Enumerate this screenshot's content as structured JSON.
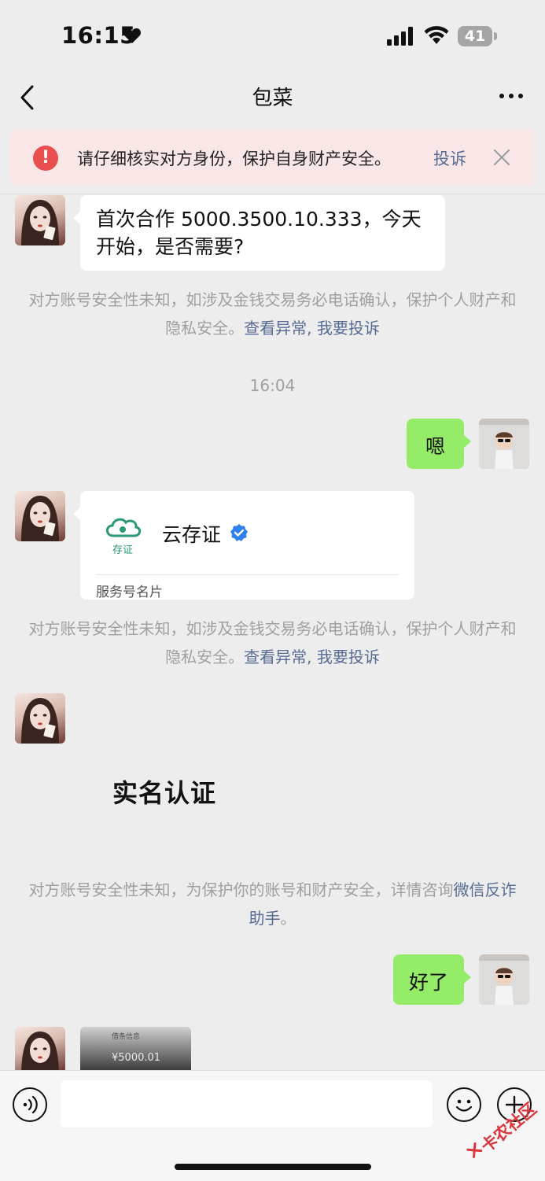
{
  "status_bar": {
    "time": "16:15",
    "battery_level": "41"
  },
  "nav": {
    "title": "包菜"
  },
  "warning": {
    "text": "请仔细核实对方身份，保护自身财产安全。",
    "report_label": "投诉"
  },
  "messages": {
    "msg1_text": "首次合作 5000.3500.10.333，今天开始，是否需要?",
    "timestamp": "16:04",
    "msg2_text": "嗯",
    "card": {
      "name": "云存证",
      "logo_label": "存证",
      "type_label": "服务号名片"
    },
    "realname_text": "实名认证",
    "msg3_text": "好了",
    "photo_line": "借条信息",
    "photo_amount": "¥5000.01"
  },
  "system_notices": {
    "notice_a_text": "对方账号安全性未知，如涉及金钱交易务必电话确认，保护个人财产和隐私安全。",
    "notice_a_link1": "查看异常",
    "notice_a_sep": ", ",
    "notice_a_link2": "我要投诉",
    "notice_b_text": "对方账号安全性未知，为保护你的账号和财产安全，详情咨询",
    "notice_b_link": "微信反诈助手",
    "notice_b_end": "。"
  },
  "input_bar": {
    "placeholder": ""
  },
  "watermark": {
    "text": "卡农社区"
  },
  "colors": {
    "background": "#ededed",
    "bubble_green": "#95ec69",
    "link_blue": "#576b95",
    "warning_red": "#ea4f4f",
    "warning_bg": "#f9e6e6"
  },
  "icons": [
    "heart-icon",
    "signal-icon",
    "wifi-icon",
    "battery-icon",
    "back-icon",
    "more-icon",
    "alert-icon",
    "close-icon",
    "verified-icon",
    "voice-icon",
    "emoji-icon",
    "plus-icon"
  ]
}
